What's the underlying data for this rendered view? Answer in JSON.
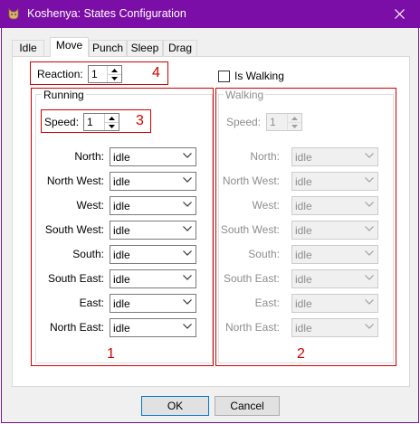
{
  "window": {
    "title": "Koshenya: States Configuration"
  },
  "tabs": [
    {
      "label": "Idle"
    },
    {
      "label": "Move"
    },
    {
      "label": "Punch"
    },
    {
      "label": "Sleep"
    },
    {
      "label": "Drag"
    }
  ],
  "active_tab": "Move",
  "reaction": {
    "label": "Reaction:",
    "value": "1"
  },
  "is_walking": {
    "label": "Is Walking",
    "checked": false
  },
  "running": {
    "title": "Running",
    "speed_label": "Speed:",
    "speed_value": "1",
    "directions": [
      {
        "label": "North:",
        "value": "idle"
      },
      {
        "label": "North West:",
        "value": "idle"
      },
      {
        "label": "West:",
        "value": "idle"
      },
      {
        "label": "South West:",
        "value": "idle"
      },
      {
        "label": "South:",
        "value": "idle"
      },
      {
        "label": "South East:",
        "value": "idle"
      },
      {
        "label": "East:",
        "value": "idle"
      },
      {
        "label": "North East:",
        "value": "idle"
      }
    ]
  },
  "walking": {
    "title": "Walking",
    "enabled": false,
    "speed_label": "Speed:",
    "speed_value": "1",
    "directions": [
      {
        "label": "North:",
        "value": "idle"
      },
      {
        "label": "North West:",
        "value": "idle"
      },
      {
        "label": "West:",
        "value": "idle"
      },
      {
        "label": "South West:",
        "value": "idle"
      },
      {
        "label": "South:",
        "value": "idle"
      },
      {
        "label": "South East:",
        "value": "idle"
      },
      {
        "label": "East:",
        "value": "idle"
      },
      {
        "label": "North East:",
        "value": "idle"
      }
    ]
  },
  "annotations": {
    "one": "1",
    "two": "2",
    "three": "3",
    "four": "4",
    "color": "#d00000"
  },
  "buttons": {
    "ok": "OK",
    "cancel": "Cancel"
  },
  "colors": {
    "titlebar": "#7b0ea6",
    "focus": "#0078d7"
  }
}
